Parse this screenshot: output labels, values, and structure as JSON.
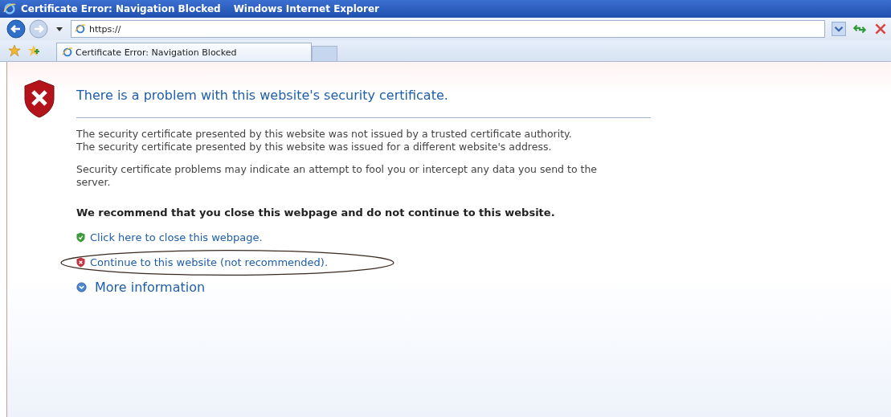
{
  "window": {
    "title": "Certificate Error: Navigation Blocked",
    "app_name": "Windows Internet Explorer"
  },
  "address_bar": {
    "value": "https://"
  },
  "tabs": [
    {
      "label": "Certificate Error: Navigation Blocked",
      "selected": true
    }
  ],
  "page": {
    "heading": "There is a problem with this website's security certificate.",
    "paragraphs": [
      [
        "The security certificate presented by this website was not issued by a trusted certificate authority.",
        "The security certificate presented by this website was issued for a different website's address."
      ],
      [
        "Security certificate problems may indicate an attempt to fool you or intercept any data you send to the server."
      ]
    ],
    "recommendation": "We recommend that you close this webpage and do not continue to this website.",
    "links": [
      {
        "kind": "safe",
        "label": "Click here to close this webpage.",
        "circled": false
      },
      {
        "kind": "unsafe",
        "label": "Continue to this website (not recommended).",
        "circled": true
      }
    ],
    "more_info": "More information"
  }
}
